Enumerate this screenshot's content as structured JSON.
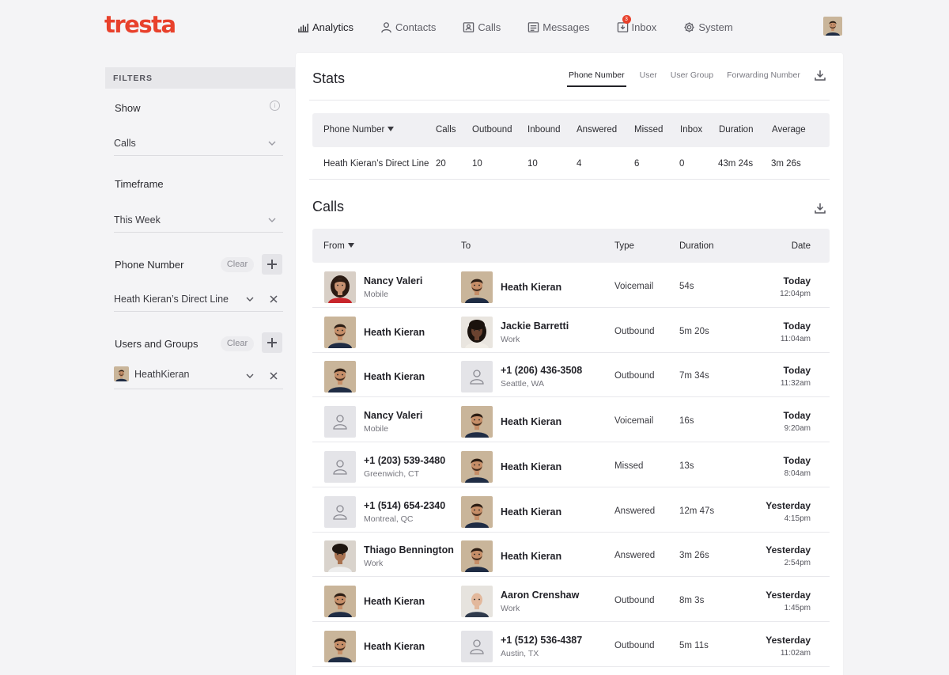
{
  "app": {
    "logo": "tresta"
  },
  "nav": {
    "items": [
      {
        "label": "Analytics",
        "icon": "bar-chart-icon",
        "active": true
      },
      {
        "label": "Contacts",
        "icon": "person-icon"
      },
      {
        "label": "Calls",
        "icon": "contact-card-icon"
      },
      {
        "label": "Messages",
        "icon": "message-icon"
      },
      {
        "label": "Inbox",
        "icon": "inbox-icon",
        "badge": "3"
      },
      {
        "label": "System",
        "icon": "gear-icon"
      }
    ]
  },
  "filters": {
    "header": "FILTERS",
    "show_label": "Show",
    "show_value": "Calls",
    "timeframe_label": "Timeframe",
    "timeframe_value": "This Week",
    "phone_label": "Phone Number",
    "phone_clear": "Clear",
    "phone_value": "Heath Kieran’s Direct Line",
    "users_label": "Users and Groups",
    "users_clear": "Clear",
    "users_value": "HeathKieran"
  },
  "stats": {
    "title": "Stats",
    "tabs": [
      "Phone Number",
      "User",
      "User Group",
      "Forwarding Number"
    ],
    "active_tab": "Phone Number",
    "columns": [
      "Phone Number",
      "Calls",
      "Outbound",
      "Inbound",
      "Answered",
      "Missed",
      "Inbox",
      "Duration",
      "Average"
    ],
    "row": [
      "Heath Kieran’s Direct Line",
      "20",
      "10",
      "10",
      "4",
      "6",
      "0",
      "43m 24s",
      "3m 26s"
    ]
  },
  "calls": {
    "title": "Calls",
    "columns": {
      "from": "From",
      "to": "To",
      "type": "Type",
      "duration": "Duration",
      "date": "Date"
    },
    "rows": [
      {
        "from_name": "Nancy Valeri",
        "from_sub": "Mobile",
        "from_avatar": "woman-red",
        "to_name": "Heath Kieran",
        "to_sub": "",
        "to_avatar": "heath",
        "type": "Voicemail",
        "duration": "54s",
        "day": "Today",
        "time": "12:04pm"
      },
      {
        "from_name": "Heath Kieran",
        "from_sub": "",
        "from_avatar": "heath",
        "to_name": "Jackie Barretti",
        "to_sub": "Work",
        "to_avatar": "woman-curly",
        "type": "Outbound",
        "duration": "5m 20s",
        "day": "Today",
        "time": "11:04am"
      },
      {
        "from_name": "Heath Kieran",
        "from_sub": "",
        "from_avatar": "heath",
        "to_name": "+1 (206) 436-3508",
        "to_sub": "Seattle, WA",
        "to_avatar": "placeholder",
        "type": "Outbound",
        "duration": "7m 34s",
        "day": "Today",
        "time": "11:32am"
      },
      {
        "from_name": "Nancy Valeri",
        "from_sub": "Mobile",
        "from_avatar": "placeholder",
        "to_name": "Heath Kieran",
        "to_sub": "",
        "to_avatar": "heath",
        "type": "Voicemail",
        "duration": "16s",
        "day": "Today",
        "time": "9:20am"
      },
      {
        "from_name": "+1 (203) 539-3480",
        "from_sub": "Greenwich, CT",
        "from_avatar": "placeholder",
        "to_name": "Heath Kieran",
        "to_sub": "",
        "to_avatar": "heath",
        "type": "Missed",
        "duration": "13s",
        "day": "Today",
        "time": "8:04am"
      },
      {
        "from_name": "+1 (514) 654-2340",
        "from_sub": "Montreal, QC",
        "from_avatar": "placeholder",
        "to_name": "Heath Kieran",
        "to_sub": "",
        "to_avatar": "heath",
        "type": "Answered",
        "duration": "12m 47s",
        "day": "Yesterday",
        "time": "4:15pm"
      },
      {
        "from_name": "Thiago Bennington",
        "from_sub": "Work",
        "from_avatar": "man-curly",
        "to_name": "Heath Kieran",
        "to_sub": "",
        "to_avatar": "heath",
        "type": "Answered",
        "duration": "3m 26s",
        "day": "Yesterday",
        "time": "2:54pm"
      },
      {
        "from_name": "Heath Kieran",
        "from_sub": "",
        "from_avatar": "heath",
        "to_name": "Aaron Crenshaw",
        "to_sub": "Work",
        "to_avatar": "man-bald",
        "type": "Outbound",
        "duration": "8m 3s",
        "day": "Yesterday",
        "time": "1:45pm"
      },
      {
        "from_name": "Heath Kieran",
        "from_sub": "",
        "from_avatar": "heath",
        "to_name": "+1 (512) 536-4387",
        "to_sub": "Austin, TX",
        "to_avatar": "placeholder",
        "type": "Outbound",
        "duration": "5m 11s",
        "day": "Yesterday",
        "time": "11:02am"
      }
    ]
  },
  "colors": {
    "brand": "#e8412c",
    "background": "#f4f4f6",
    "card": "#ffffff",
    "header_row": "#f0f0f3"
  }
}
